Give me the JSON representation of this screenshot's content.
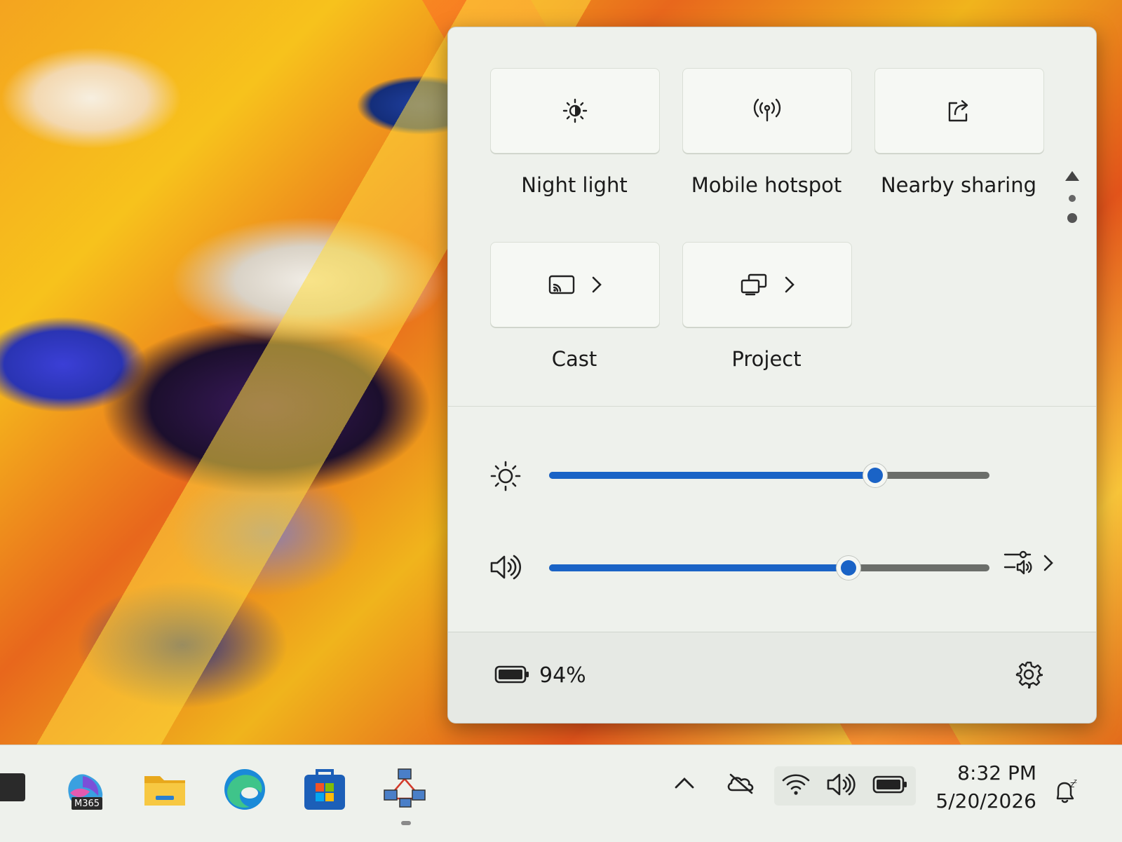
{
  "quick_settings": {
    "tiles": [
      {
        "label": "Night light",
        "icon": "night-light-icon"
      },
      {
        "label": "Mobile hotspot",
        "icon": "hotspot-icon"
      },
      {
        "label": "Nearby sharing",
        "icon": "share-icon"
      },
      {
        "label": "Cast",
        "icon": "cast-icon",
        "has_chevron": true
      },
      {
        "label": "Project",
        "icon": "project-icon",
        "has_chevron": true
      }
    ],
    "pager_icon": "chevron-up-icon",
    "brightness": {
      "icon": "brightness-icon",
      "value": 0.74
    },
    "volume": {
      "icon": "speaker-icon",
      "value": 0.68,
      "output_icon": "audio-output-icon"
    },
    "battery": {
      "icon": "battery-icon",
      "percent": "94%"
    },
    "settings_icon": "gear-icon"
  },
  "taskbar": {
    "apps": [
      {
        "name": "Microsoft 365",
        "badge": "M365"
      },
      {
        "name": "File Explorer"
      },
      {
        "name": "Microsoft Edge"
      },
      {
        "name": "Microsoft Store"
      },
      {
        "name": "Network app"
      }
    ],
    "tray": [
      "chevron-up-icon",
      "onedrive-icon",
      "wifi-icon",
      "speaker-icon",
      "battery-icon"
    ],
    "time": "8:32 PM",
    "date": "5/20/2026",
    "notification_icon": "notification-bell-icon"
  },
  "colors": {
    "accent": "#1a63c6",
    "flyout_bg": "#eef1ec"
  }
}
